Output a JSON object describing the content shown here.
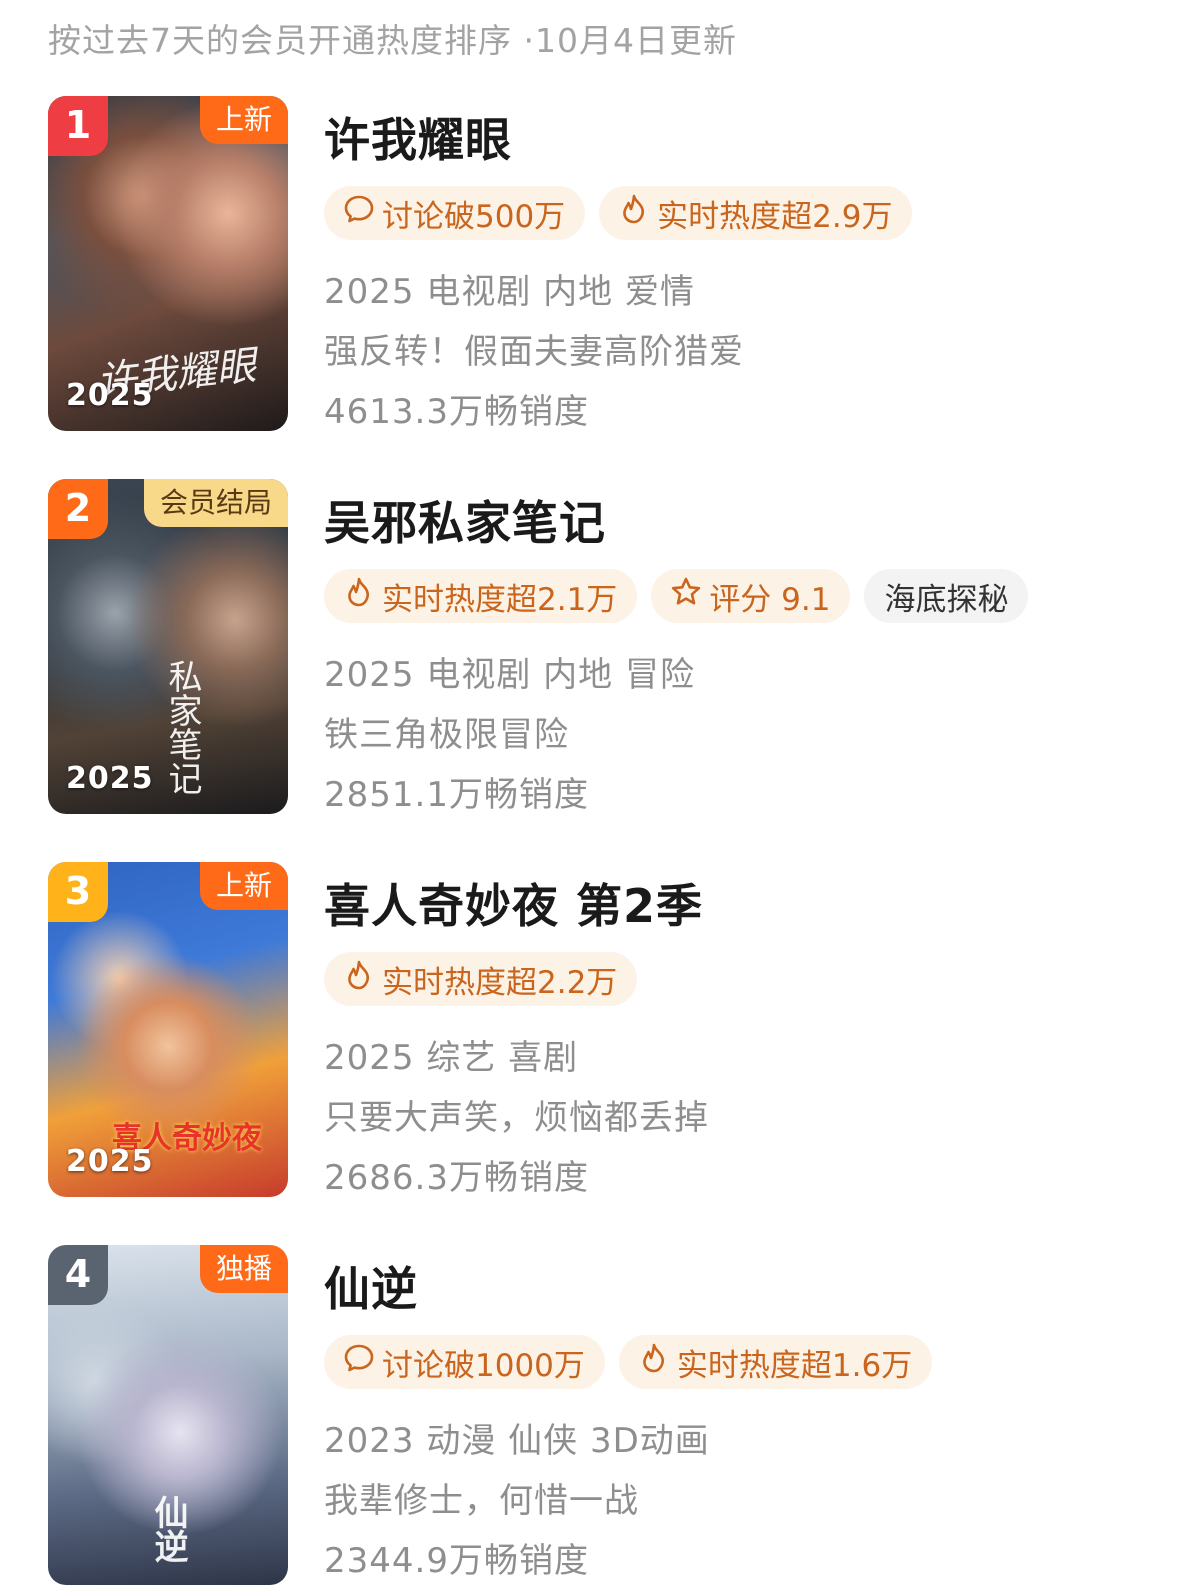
{
  "header": {
    "subtitle": "按过去7天的会员开通热度排序 ·10月4日更新"
  },
  "colors": {
    "rank1": "#ef3d44",
    "rank2": "#ff6a18",
    "rank3": "#ffb21a",
    "rank4": "#5a6370",
    "corner_new": "#ff6a18",
    "corner_member": "#f8d98a",
    "chip_bg": "#fdf2e6",
    "chip_text": "#c9651c"
  },
  "items": [
    {
      "rank": "1",
      "corner_tag": "上新",
      "poster_year": "2025",
      "poster_title_art": "许我耀眼",
      "title": "许我耀眼",
      "chips": [
        {
          "icon": "comment-icon",
          "text": "讨论破500万"
        },
        {
          "icon": "flame-icon",
          "text": "实时热度超2.9万"
        }
      ],
      "meta": "2025 电视剧 内地 爱情",
      "tagline": "强反转！假面夫妻高阶猎爱",
      "sales": "4613.3万畅销度"
    },
    {
      "rank": "2",
      "corner_tag": "会员结局",
      "poster_year": "2025",
      "poster_title_art": "私家笔记",
      "title": "吴邪私家笔记",
      "chips": [
        {
          "icon": "flame-icon",
          "text": "实时热度超2.1万"
        },
        {
          "icon": "star-icon",
          "text": "评分 9.1"
        },
        {
          "icon": "",
          "text": "海底探秘"
        }
      ],
      "meta": "2025 电视剧 内地 冒险",
      "tagline": "铁三角极限冒险",
      "sales": "2851.1万畅销度"
    },
    {
      "rank": "3",
      "corner_tag": "上新",
      "poster_year": "2025",
      "poster_title_art": "喜人奇妙夜",
      "title": "喜人奇妙夜 第2季",
      "chips": [
        {
          "icon": "flame-icon",
          "text": "实时热度超2.2万"
        }
      ],
      "meta": "2025 综艺 喜剧",
      "tagline": "只要大声笑，烦恼都丢掉",
      "sales": "2686.3万畅销度"
    },
    {
      "rank": "4",
      "corner_tag": "独播",
      "poster_year": "",
      "poster_title_art": "仙逆",
      "title": "仙逆",
      "chips": [
        {
          "icon": "comment-icon",
          "text": "讨论破1000万"
        },
        {
          "icon": "flame-icon",
          "text": "实时热度超1.6万"
        }
      ],
      "meta": "2023 动漫 仙侠 3D动画",
      "tagline": "我辈修士，何惜一战",
      "sales": "2344.9万畅销度"
    }
  ]
}
